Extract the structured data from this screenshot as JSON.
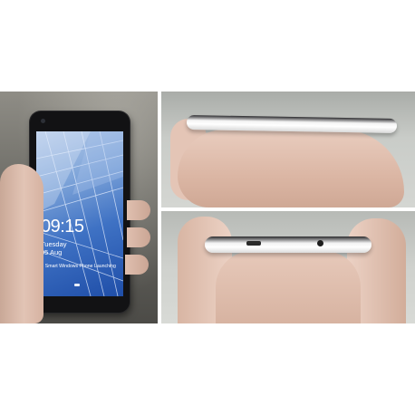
{
  "lockscreen": {
    "time": "09:15",
    "day": "Tuesday",
    "date": "05 Aug",
    "notification": "Smart Windows Phone Launching"
  },
  "colors": {
    "background": "#ffffff",
    "phone_body": "#121214",
    "screen_accent": "#3f72c4"
  }
}
